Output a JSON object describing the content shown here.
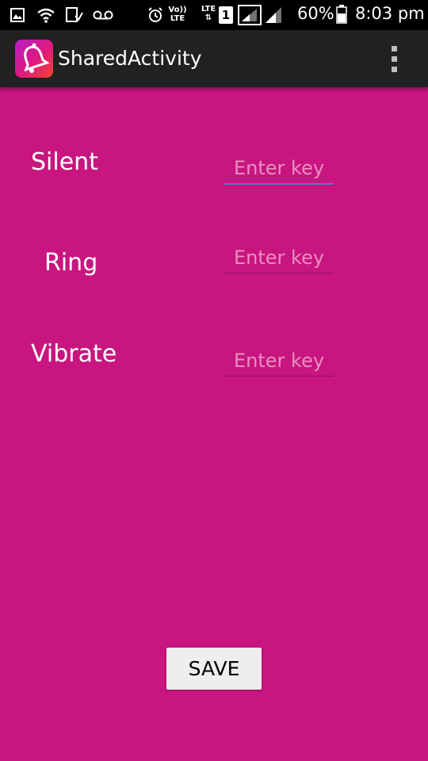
{
  "status_bar": {
    "battery": "60%",
    "time": "8:03 pm",
    "sim_slot": "1",
    "network_top": "LTE",
    "volte_top": "Vo))",
    "volte_bottom": "LTE",
    "icons": [
      "gallery-icon",
      "wifi-icon",
      "download-icon",
      "voicemail-icon",
      "alarm-icon",
      "volte-icon",
      "lte-data-icon",
      "sim-icon",
      "signal-icon",
      "battery-icon"
    ]
  },
  "action_bar": {
    "title": "SharedActivity",
    "app_icon": "bell-icon",
    "menu_icon": "overflow-menu-icon"
  },
  "form": {
    "rows": [
      {
        "label": "Silent",
        "placeholder": "Enter key",
        "value": ""
      },
      {
        "label": "Ring",
        "placeholder": "Enter key",
        "value": ""
      },
      {
        "label": "Vibrate",
        "placeholder": "Enter key",
        "value": ""
      }
    ],
    "save_label": "SAVE"
  },
  "colors": {
    "background": "#c8157f",
    "action_bar": "#212121",
    "status_bar": "#000000",
    "focus_underline": "#3f7fd6",
    "button": "#eeeeee"
  }
}
